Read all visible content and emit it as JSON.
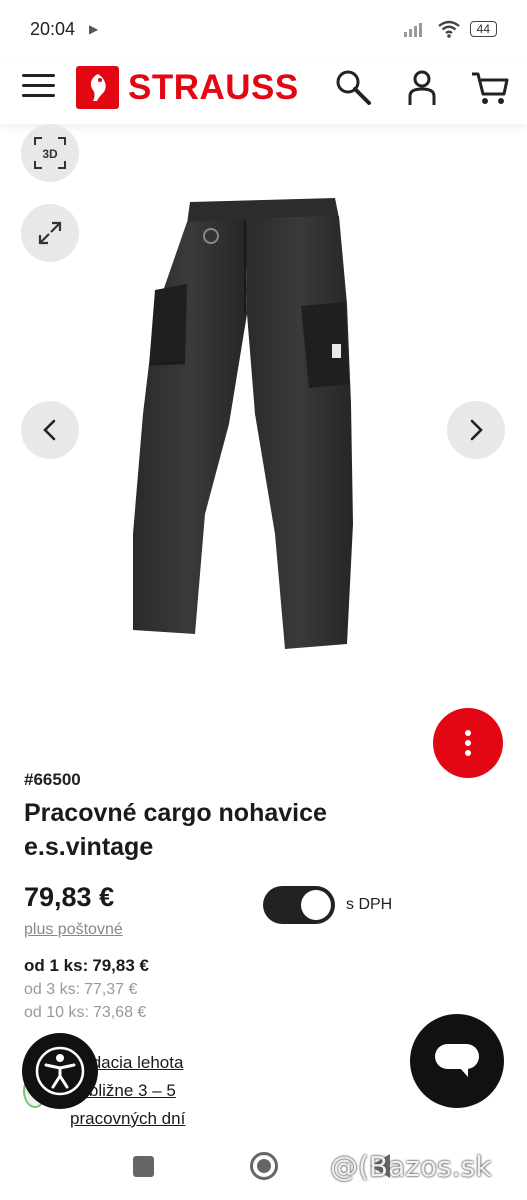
{
  "status_bar": {
    "time": "20:04",
    "battery": "44"
  },
  "header": {
    "brand": "STRAUSS",
    "icons": [
      "menu-icon",
      "search-icon",
      "account-icon",
      "cart-icon"
    ]
  },
  "gallery": {
    "badge_3d": "3D",
    "icons": [
      "expand-icon",
      "chevron-left-icon",
      "chevron-right-icon"
    ]
  },
  "product": {
    "sku": "#66500",
    "title": "Pracovné cargo nohavice e.s.vintage",
    "price": "79,83 €",
    "shipping": "plus poštovné",
    "vat_toggle_label": "s DPH",
    "vat_toggle_on": true,
    "tiers": [
      {
        "qty": "od 1 ks:",
        "price": "79,83 €"
      },
      {
        "qty": "od 3 ks:",
        "price": "77,37 €"
      },
      {
        "qty": "od 10 ks:",
        "price": "73,68 €"
      }
    ],
    "delivery_lines": [
      "Dodacia lehota",
      "približne 3 – 5",
      "pracovných dní"
    ]
  },
  "watermark": "@(Bazos.sk",
  "colors": {
    "brand_red": "#e30613",
    "dark": "#111111"
  }
}
